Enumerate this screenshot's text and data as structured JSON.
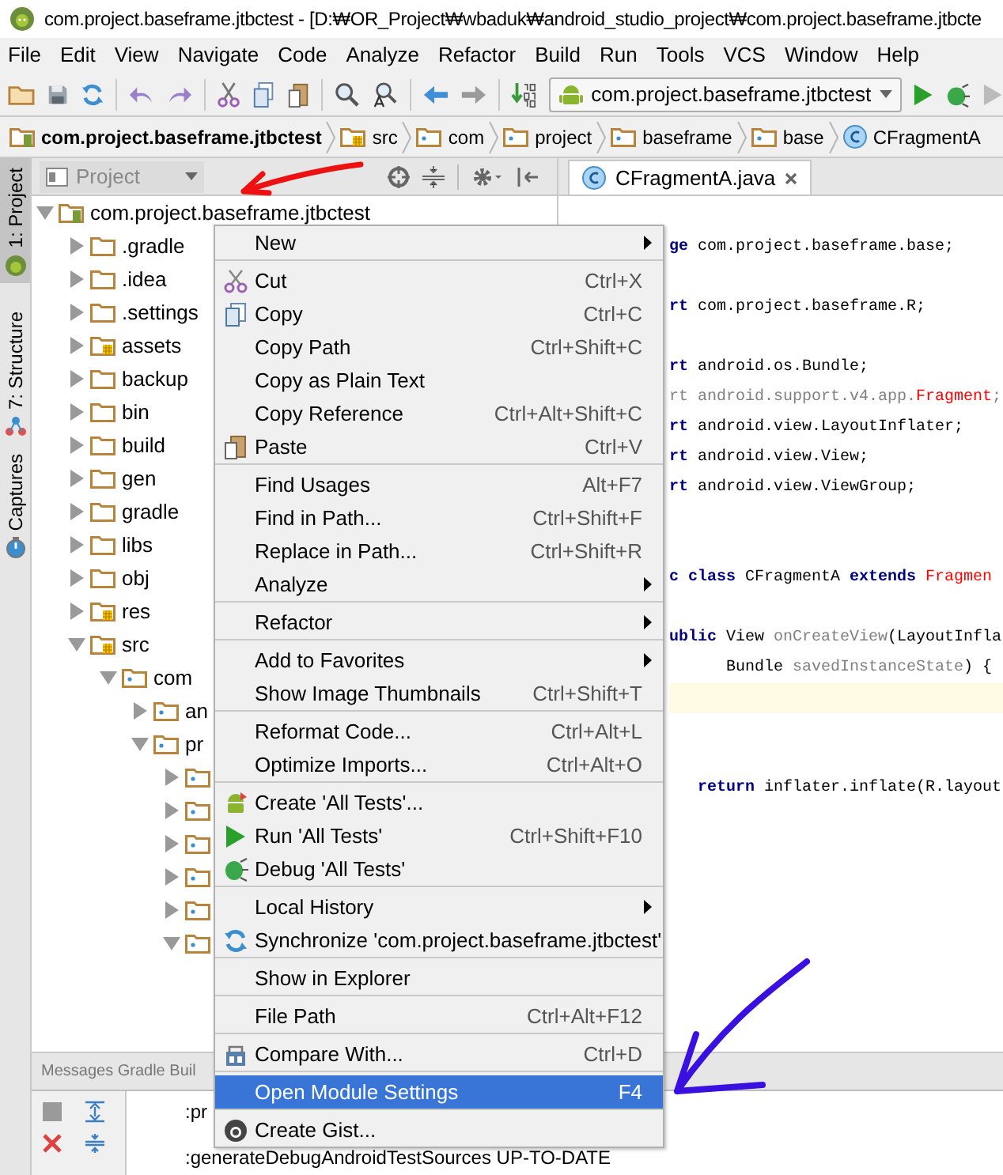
{
  "window": {
    "title": "com.project.baseframe.jtbctest - [D:₩OR_Project₩wbaduk₩android_studio_project₩com.project.baseframe.jtbcte"
  },
  "menu": [
    "File",
    "Edit",
    "View",
    "Navigate",
    "Code",
    "Analyze",
    "Refactor",
    "Build",
    "Run",
    "Tools",
    "VCS",
    "Window",
    "Help"
  ],
  "toolbar": {
    "run_config": "com.project.baseframe.jtbctest"
  },
  "breadcrumbs": [
    {
      "label": "com.project.baseframe.jtbctest",
      "kind": "module"
    },
    {
      "label": "src",
      "kind": "source"
    },
    {
      "label": "com",
      "kind": "package"
    },
    {
      "label": "project",
      "kind": "package"
    },
    {
      "label": "baseframe",
      "kind": "package"
    },
    {
      "label": "base",
      "kind": "package"
    },
    {
      "label": "CFragmentA",
      "kind": "class"
    }
  ],
  "tool_strip": [
    {
      "label": "1: Project",
      "selected": true
    },
    {
      "label": "7: Structure",
      "selected": false
    },
    {
      "label": "Captures",
      "selected": false
    }
  ],
  "project_panel": {
    "view": "Project",
    "tree": [
      {
        "label": "com.project.baseframe.jtbctest",
        "kind": "module",
        "expanded": true,
        "children": [
          {
            "label": ".gradle",
            "kind": "folder",
            "expanded": false
          },
          {
            "label": ".idea",
            "kind": "folder",
            "expanded": false
          },
          {
            "label": ".settings",
            "kind": "folder",
            "expanded": false
          },
          {
            "label": "assets",
            "kind": "source",
            "expanded": false
          },
          {
            "label": "backup",
            "kind": "folder",
            "expanded": false
          },
          {
            "label": "bin",
            "kind": "folder",
            "expanded": false
          },
          {
            "label": "build",
            "kind": "folder",
            "expanded": false
          },
          {
            "label": "gen",
            "kind": "folder",
            "expanded": false
          },
          {
            "label": "gradle",
            "kind": "folder",
            "expanded": false
          },
          {
            "label": "libs",
            "kind": "folder",
            "expanded": false
          },
          {
            "label": "obj",
            "kind": "folder",
            "expanded": false
          },
          {
            "label": "res",
            "kind": "source",
            "expanded": false
          },
          {
            "label": "src",
            "kind": "source",
            "expanded": true,
            "children": [
              {
                "label": "com",
                "kind": "package",
                "expanded": true,
                "children": [
                  {
                    "label": "an",
                    "kind": "package",
                    "expanded": false
                  },
                  {
                    "label": "pr",
                    "kind": "package",
                    "expanded": true,
                    "children": [
                      {
                        "kind": "package",
                        "expanded": false
                      },
                      {
                        "kind": "package",
                        "expanded": false
                      },
                      {
                        "kind": "package",
                        "expanded": false
                      },
                      {
                        "kind": "package",
                        "expanded": false
                      },
                      {
                        "kind": "package",
                        "expanded": false
                      },
                      {
                        "kind": "package",
                        "expanded": true
                      }
                    ]
                  }
                ]
              }
            ]
          }
        ]
      }
    ]
  },
  "editor": {
    "tabs": [
      {
        "label": "CFragmentA.java",
        "selected": true
      }
    ],
    "lines": [
      {
        "kind": "code",
        "tokens": [
          {
            "text": "ge",
            "kind": "keyword"
          },
          {
            "text": " com.project.baseframe.base;",
            "kind": "plain"
          }
        ]
      },
      {
        "kind": "blank"
      },
      {
        "kind": "code",
        "tokens": [
          {
            "text": "rt",
            "kind": "keyword"
          },
          {
            "text": " com.project.baseframe.R;",
            "kind": "plain"
          }
        ]
      },
      {
        "kind": "blank"
      },
      {
        "kind": "code",
        "tokens": [
          {
            "text": "rt",
            "kind": "keyword"
          },
          {
            "text": " android.os.Bundle;",
            "kind": "plain"
          }
        ]
      },
      {
        "kind": "code",
        "tokens": [
          {
            "text": "rt android.support.v4.app.",
            "kind": "muted"
          },
          {
            "text": "Fragment",
            "kind": "error"
          },
          {
            "text": ";",
            "kind": "muted"
          }
        ]
      },
      {
        "kind": "code",
        "tokens": [
          {
            "text": "rt",
            "kind": "keyword"
          },
          {
            "text": " android.view.LayoutInflater;",
            "kind": "plain"
          }
        ]
      },
      {
        "kind": "code",
        "tokens": [
          {
            "text": "rt",
            "kind": "keyword"
          },
          {
            "text": " android.view.View;",
            "kind": "plain"
          }
        ]
      },
      {
        "kind": "code",
        "tokens": [
          {
            "text": "rt",
            "kind": "keyword"
          },
          {
            "text": " android.view.ViewGroup;",
            "kind": "plain"
          }
        ]
      },
      {
        "kind": "blank"
      },
      {
        "kind": "blank"
      },
      {
        "kind": "code",
        "tokens": [
          {
            "text": "c class",
            "kind": "keyword"
          },
          {
            "text": " CFragmentA ",
            "kind": "plain"
          },
          {
            "text": "extends ",
            "kind": "keyword"
          },
          {
            "text": "Fragmen",
            "kind": "error"
          }
        ]
      },
      {
        "kind": "blank"
      },
      {
        "kind": "code",
        "tokens": [
          {
            "text": "ublic",
            "kind": "keyword"
          },
          {
            "text": " View ",
            "kind": "plain"
          },
          {
            "text": "onCreateView",
            "kind": "muted"
          },
          {
            "text": "(LayoutInfla",
            "kind": "plain"
          }
        ]
      },
      {
        "kind": "code",
        "tokens": [
          {
            "text": "      Bundle ",
            "kind": "plain"
          },
          {
            "text": "savedInstanceState",
            "kind": "muted"
          },
          {
            "text": ") {",
            "kind": "plain"
          }
        ]
      },
      {
        "kind": "current"
      },
      {
        "kind": "blank"
      },
      {
        "kind": "blank"
      },
      {
        "kind": "code",
        "tokens": [
          {
            "text": "   return",
            "kind": "keyword"
          },
          {
            "text": " inflater.inflate(R.layout",
            "kind": "plain"
          }
        ]
      }
    ]
  },
  "context_menu": {
    "groups": [
      [
        {
          "label": "New",
          "submenu": true,
          "selected": false
        }
      ],
      [
        {
          "label": "Cut",
          "shortcut": "Ctrl+X",
          "submenu": false,
          "selected": false
        },
        {
          "label": "Copy",
          "shortcut": "Ctrl+C",
          "submenu": false,
          "selected": false
        },
        {
          "label": "Copy Path",
          "shortcut": "Ctrl+Shift+C",
          "submenu": false,
          "selected": false
        },
        {
          "label": "Copy as Plain Text",
          "submenu": false,
          "selected": false
        },
        {
          "label": "Copy Reference",
          "shortcut": "Ctrl+Alt+Shift+C",
          "submenu": false,
          "selected": false
        },
        {
          "label": "Paste",
          "shortcut": "Ctrl+V",
          "submenu": false,
          "selected": false
        }
      ],
      [
        {
          "label": "Find Usages",
          "shortcut": "Alt+F7",
          "submenu": false,
          "selected": false
        },
        {
          "label": "Find in Path...",
          "shortcut": "Ctrl+Shift+F",
          "submenu": false,
          "selected": false
        },
        {
          "label": "Replace in Path...",
          "shortcut": "Ctrl+Shift+R",
          "submenu": false,
          "selected": false
        },
        {
          "label": "Analyze",
          "submenu": true,
          "selected": false
        }
      ],
      [
        {
          "label": "Refactor",
          "submenu": true,
          "selected": false
        }
      ],
      [
        {
          "label": "Add to Favorites",
          "submenu": true,
          "selected": false
        },
        {
          "label": "Show Image Thumbnails",
          "shortcut": "Ctrl+Shift+T",
          "submenu": false,
          "selected": false
        }
      ],
      [
        {
          "label": "Reformat Code...",
          "shortcut": "Ctrl+Alt+L",
          "submenu": false,
          "selected": false
        },
        {
          "label": "Optimize Imports...",
          "shortcut": "Ctrl+Alt+O",
          "submenu": false,
          "selected": false
        }
      ],
      [
        {
          "label": "Create 'All Tests'...",
          "submenu": false,
          "selected": false
        },
        {
          "label": "Run 'All Tests'",
          "shortcut": "Ctrl+Shift+F10",
          "submenu": false,
          "selected": false
        },
        {
          "label": "Debug 'All Tests'",
          "submenu": false,
          "selected": false
        }
      ],
      [
        {
          "label": "Local History",
          "submenu": true,
          "selected": false
        },
        {
          "label": "Synchronize 'com.project.baseframe.jtbctest'",
          "submenu": false,
          "selected": false
        }
      ],
      [
        {
          "label": "Show in Explorer",
          "submenu": false,
          "selected": false
        }
      ],
      [
        {
          "label": "File Path",
          "shortcut": "Ctrl+Alt+F12",
          "submenu": false,
          "selected": false
        }
      ],
      [
        {
          "label": "Compare With...",
          "shortcut": "Ctrl+D",
          "submenu": false,
          "selected": false
        }
      ],
      [
        {
          "label": "Open Module Settings",
          "shortcut": "F4",
          "submenu": false,
          "selected": true
        }
      ],
      [
        {
          "label": "Create Gist...",
          "submenu": false,
          "selected": false
        }
      ]
    ]
  },
  "messages": {
    "tabs_label": "Messages Gradle Buil",
    "lines": [
      ":pr",
      ":generateDebugAndroidTestSources UP-TO-DATE"
    ]
  }
}
